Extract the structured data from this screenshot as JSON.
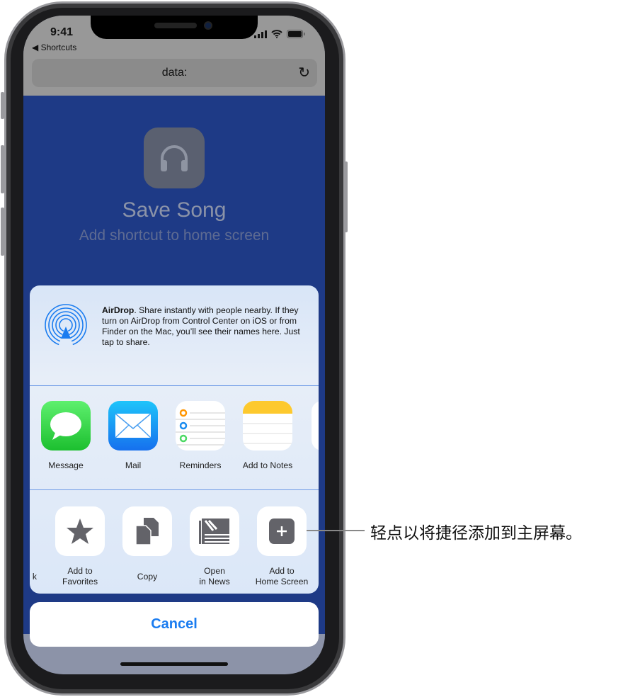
{
  "status_bar": {
    "time": "9:41",
    "back_label": "◀ Shortcuts"
  },
  "browser": {
    "url": "data:",
    "reload_icon": "reload-icon"
  },
  "web": {
    "title": "Save Song",
    "subtitle": "Add shortcut to home screen",
    "icon": "headphones-icon"
  },
  "share_sheet": {
    "airdrop": {
      "bold": "AirDrop",
      "text": ". Share instantly with people nearby. If they turn on AirDrop from Control Center on iOS or from Finder on the Mac, you’ll see their names here. Just tap to share."
    },
    "apps": [
      {
        "label": "Message"
      },
      {
        "label": "Mail"
      },
      {
        "label": "Reminders"
      },
      {
        "label": "Add to Notes"
      }
    ],
    "actions": [
      {
        "label": "k"
      },
      {
        "label": "Add to\nFavorites"
      },
      {
        "label": "Copy"
      },
      {
        "label": "Open\nin News"
      },
      {
        "label": "Add to\nHome Screen"
      }
    ],
    "cancel": "Cancel"
  },
  "callout": "轻点以将捷径添加到主屏幕。",
  "colors": {
    "accent": "#1a7cf0",
    "web_bg": "#1e3a86"
  }
}
